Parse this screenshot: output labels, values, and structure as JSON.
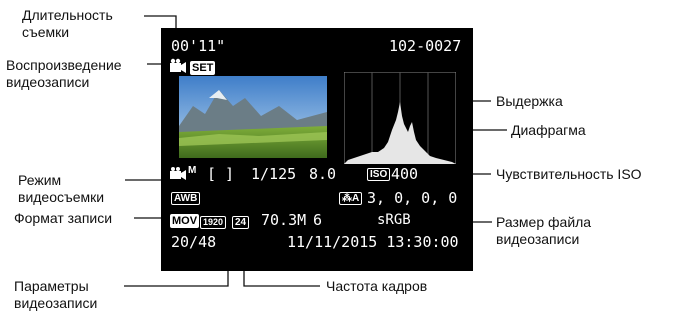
{
  "labels": {
    "duration": "Длительность съемки",
    "playback": "Воспроизведение видеозаписи",
    "shutter": "Выдержка",
    "aperture": "Диафрагма",
    "iso": "Чувствительность ISO",
    "movie_mode": "Режим видеосъемки",
    "rec_format": "Формат записи",
    "file_size": "Размер файла видеозаписи",
    "rec_params": "Параметры видеозаписи",
    "frame_rate": "Частота кадров"
  },
  "screen": {
    "duration": "00'11\"",
    "folder_file": "102-0027",
    "set_label": "SET",
    "shutter": "1/125",
    "aperture": "8.0",
    "iso_label": "ISO",
    "iso": "400",
    "wb": "AWB",
    "style_icon": "A",
    "style_values": "3, 0, 0, 0",
    "format": "MOV",
    "size_badge": "1920",
    "fps_badge": "24",
    "file_size": "70.3M",
    "compression": "6",
    "color_space": "sRGB",
    "counter": "20/48",
    "datetime": "11/11/2015 13:30:00"
  },
  "icons": {
    "playback": "movie-playback-icon",
    "movie_mode": "movie-camera-manual-icon",
    "metering": "spot-metering-bracket-icon",
    "style": "picture-style-auto-icon"
  },
  "colors": {
    "screen_bg": "#000000",
    "text": "#ffffff",
    "lines": "#111111"
  }
}
